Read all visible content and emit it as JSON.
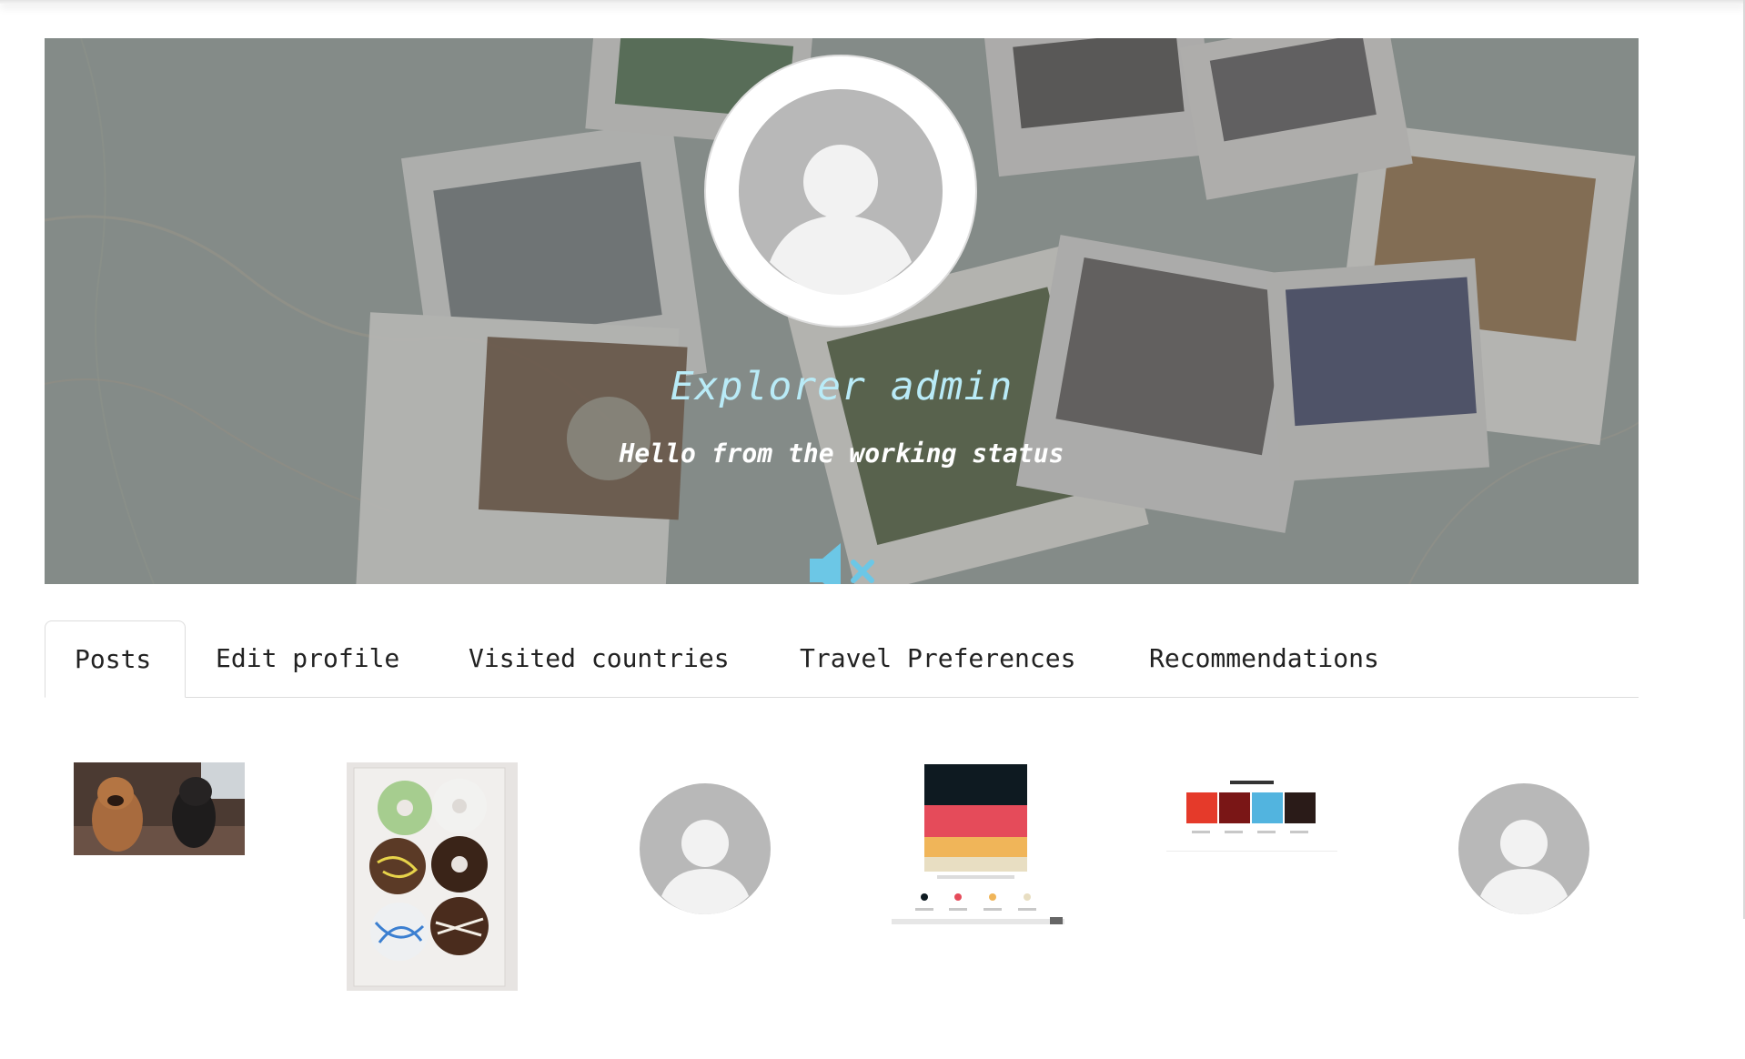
{
  "profile": {
    "name": "Explorer admin",
    "status": "Hello from the working status"
  },
  "controls": {
    "mute_icon": "volume-mute-icon"
  },
  "tabs": [
    {
      "label": "Posts",
      "active": true
    },
    {
      "label": "Edit profile",
      "active": false
    },
    {
      "label": "Visited countries",
      "active": false
    },
    {
      "label": "Travel Preferences",
      "active": false
    },
    {
      "label": "Recommendations",
      "active": false
    }
  ],
  "posts": [
    {
      "kind": "photo",
      "subject": "two dogs"
    },
    {
      "kind": "photo",
      "subject": "box of donuts"
    },
    {
      "kind": "placeholder-avatar"
    },
    {
      "kind": "palette-screenshot",
      "hex_codes": [
        "#0E1A21",
        "#E54B5A",
        "#F0B559",
        "#E8DEC2"
      ]
    },
    {
      "kind": "palette-screenshot",
      "title": "Switch Palette",
      "colors": [
        "#E53A2A",
        "#7A1616",
        "#52B4DF",
        "#2A1B18"
      ]
    },
    {
      "kind": "placeholder-avatar"
    }
  ],
  "colors": {
    "accent": "#6cc7e6",
    "name_text": "#b9ebf7",
    "tab_border": "#dcdcdc"
  }
}
